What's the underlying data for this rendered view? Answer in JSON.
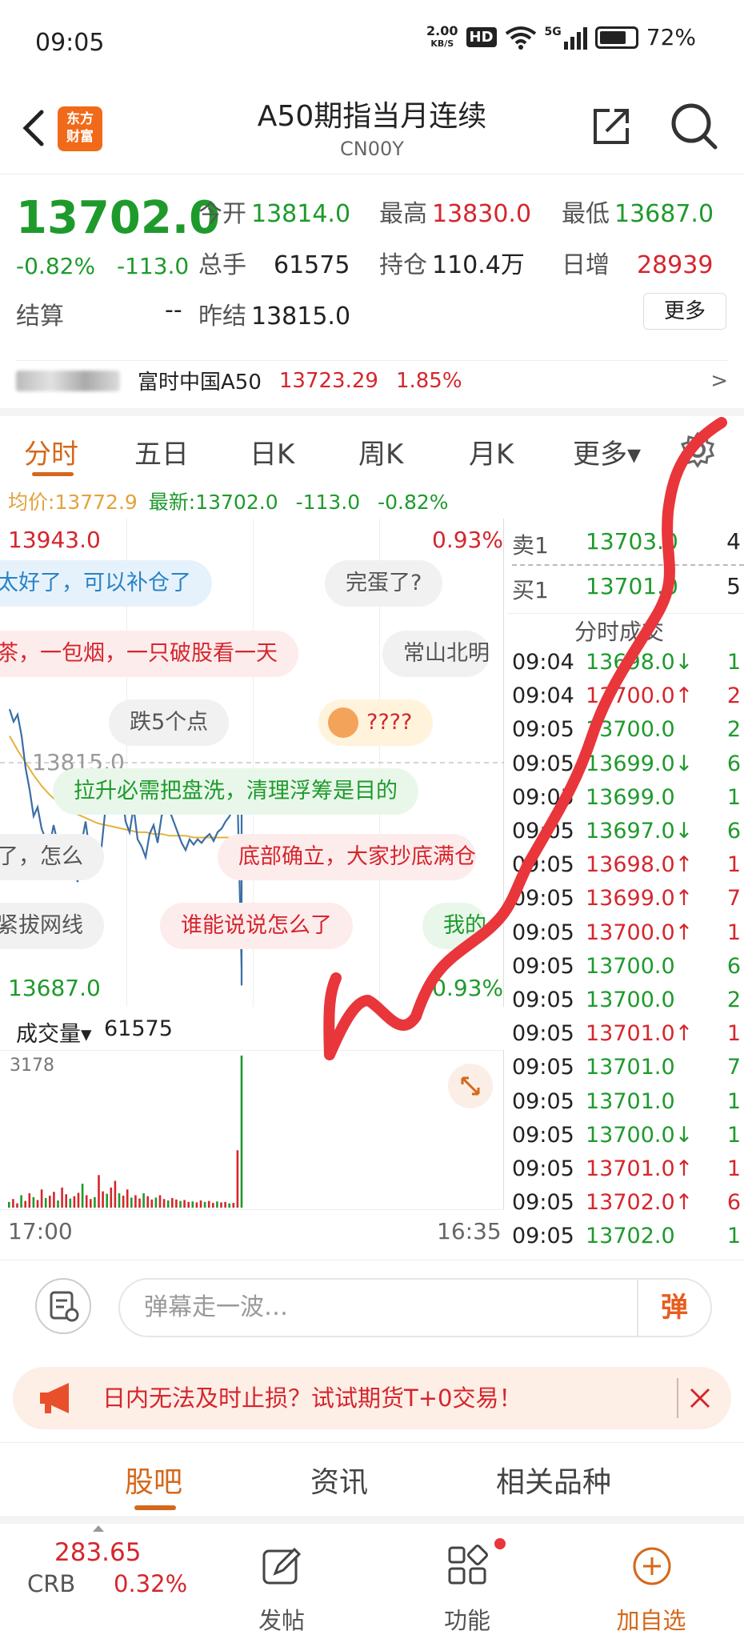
{
  "status": {
    "time": "09:05",
    "net_speed_value": "2.00",
    "net_speed_unit": "KB/S",
    "hd": "HD",
    "signal_label": "5G",
    "battery": "72%"
  },
  "header": {
    "logo_line1": "东方",
    "logo_line2": "财富",
    "title": "A50期指当月连续",
    "code": "CN00Y"
  },
  "quote": {
    "price": "13702.0",
    "change_pct": "-0.82%",
    "change": "-113.0",
    "open_label": "今开",
    "open": "13814.0",
    "high_label": "最高",
    "high": "13830.0",
    "low_label": "最低",
    "low": "13687.0",
    "volume_label": "总手",
    "volume": "61575",
    "oi_label": "持仓",
    "oi": "110.4万",
    "daily_inc_label": "日增",
    "daily_inc": "28939",
    "settle_label": "结算",
    "settle": "--",
    "prev_settle_label": "昨结",
    "prev_settle": "13815.0",
    "more": "更多",
    "related_name": "富时中国A50",
    "related_price": "13723.29",
    "related_pct": "1.85%",
    "related_arrow": ">"
  },
  "tabs": [
    {
      "label": "分时"
    },
    {
      "label": "五日"
    },
    {
      "label": "日K"
    },
    {
      "label": "周K"
    },
    {
      "label": "月K"
    },
    {
      "label": "更多▾"
    }
  ],
  "chart_info": {
    "avg_label": "均价:",
    "avg": "13772.9",
    "latest_label": "最新:",
    "latest": "13702.0",
    "change": "-113.0",
    "pct": "-0.82%"
  },
  "chart_data": {
    "type": "line",
    "y_top": "13943.0",
    "y_top_pct": "0.93%",
    "y_ref": "13815.0",
    "y_bottom": "13687.0",
    "y_bottom_pct": "-0.93%",
    "ylim": [
      13687.0,
      13943.0
    ],
    "x_start": "17:00",
    "x_end": "16:35",
    "price_series": [
      13845,
      13838,
      13842,
      13830,
      13812,
      13800,
      13785,
      13790,
      13778,
      13772,
      13768,
      13780,
      13770,
      13758,
      13752,
      13765,
      13760,
      13748,
      13770,
      13782,
      13765,
      13772,
      13760,
      13768,
      13790,
      13805,
      13795,
      13810,
      13800,
      13782,
      13776,
      13790,
      13772,
      13768,
      13762,
      13775,
      13780,
      13770,
      13785,
      13792,
      13788,
      13782,
      13776,
      13770,
      13766,
      13772,
      13769,
      13772,
      13770,
      13773,
      13775,
      13771,
      13776,
      13778,
      13782,
      13785,
      13790,
      13794,
      13700
    ],
    "avg_series": [
      13830,
      13822,
      13815,
      13808,
      13802,
      13797,
      13793,
      13790,
      13787,
      13785,
      13783,
      13781,
      13780,
      13779,
      13778,
      13777,
      13776,
      13776,
      13775,
      13775,
      13774,
      13774,
      13774,
      13773,
      13773,
      13773,
      13773,
      13773,
      13773,
      13773
    ],
    "volume_label": "成交量▾",
    "volume_total": "61575",
    "volume_max": "3178",
    "volume_bars": [
      120,
      180,
      90,
      260,
      140,
      300,
      220,
      160,
      380,
      200,
      250,
      330,
      150,
      420,
      280,
      190,
      240,
      310,
      500,
      260,
      180,
      220,
      680,
      340,
      290,
      420,
      560,
      300,
      250,
      380,
      210,
      260,
      190,
      300,
      240,
      170,
      210,
      260,
      180,
      150,
      200,
      170,
      140,
      160,
      120,
      130,
      110,
      150,
      120,
      140,
      100,
      130,
      110,
      120,
      90,
      100,
      1200,
      3178
    ]
  },
  "danmu": [
    {
      "text": "太好了，可以补仓了",
      "style": "blue"
    },
    {
      "text": "完蛋了?",
      "style": "gray"
    },
    {
      "text": "茶，一包烟，一只破股看一天",
      "style": "red"
    },
    {
      "text": "常山北明",
      "style": "gray"
    },
    {
      "text": "跌5个点",
      "style": "gray"
    },
    {
      "text": "????",
      "style": "yellow"
    },
    {
      "text": "拉升必需把盘洗，清理浮筹是目的",
      "style": "green"
    },
    {
      "text": "了，怎么",
      "style": "gray"
    },
    {
      "text": "底部确立，大家抄底满仓",
      "style": "red"
    },
    {
      "text": "紧拔网线",
      "style": "gray"
    },
    {
      "text": "谁能说说怎么了",
      "style": "red"
    },
    {
      "text": "我的",
      "style": "green"
    }
  ],
  "book": {
    "sell_label": "卖1",
    "sell_price": "13703.0",
    "sell_vol": "4",
    "buy_label": "买1",
    "buy_price": "13701.0",
    "buy_vol": "5",
    "ticks_title": "分时成交",
    "ticks": [
      {
        "time": "09:04",
        "price": "13698.0↓",
        "vol": "1",
        "dir": "down"
      },
      {
        "time": "09:04",
        "price": "13700.0↑",
        "vol": "2",
        "dir": "up"
      },
      {
        "time": "09:05",
        "price": "13700.0",
        "vol": "2",
        "dir": "flat"
      },
      {
        "time": "09:05",
        "price": "13699.0↓",
        "vol": "6",
        "dir": "down"
      },
      {
        "time": "09:05",
        "price": "13699.0",
        "vol": "1",
        "dir": "flat"
      },
      {
        "time": "09:05",
        "price": "13697.0↓",
        "vol": "6",
        "dir": "down"
      },
      {
        "time": "09:05",
        "price": "13698.0↑",
        "vol": "1",
        "dir": "up"
      },
      {
        "time": "09:05",
        "price": "13699.0↑",
        "vol": "7",
        "dir": "up"
      },
      {
        "time": "09:05",
        "price": "13700.0↑",
        "vol": "1",
        "dir": "up"
      },
      {
        "time": "09:05",
        "price": "13700.0",
        "vol": "6",
        "dir": "flat"
      },
      {
        "time": "09:05",
        "price": "13700.0",
        "vol": "2",
        "dir": "flat"
      },
      {
        "time": "09:05",
        "price": "13701.0↑",
        "vol": "1",
        "dir": "up"
      },
      {
        "time": "09:05",
        "price": "13701.0",
        "vol": "7",
        "dir": "flat"
      },
      {
        "time": "09:05",
        "price": "13701.0",
        "vol": "1",
        "dir": "flat"
      },
      {
        "time": "09:05",
        "price": "13700.0↓",
        "vol": "1",
        "dir": "down"
      },
      {
        "time": "09:05",
        "price": "13701.0↑",
        "vol": "1",
        "dir": "up"
      },
      {
        "time": "09:05",
        "price": "13702.0↑",
        "vol": "6",
        "dir": "up"
      },
      {
        "time": "09:05",
        "price": "13702.0",
        "vol": "1",
        "dir": "flat"
      }
    ]
  },
  "comment": {
    "placeholder": "弹幕走一波…",
    "send": "弹"
  },
  "promo": {
    "text": "日内无法及时止损？试试期货T+0交易！"
  },
  "subtabs": [
    {
      "label": "股吧"
    },
    {
      "label": "资讯"
    },
    {
      "label": "相关品种"
    }
  ],
  "nav": {
    "crb_value": "283.65",
    "crb_label": "CRB",
    "crb_pct": "0.32%",
    "post": "发帖",
    "func": "功能",
    "add": "加自选"
  },
  "colors": {
    "accent": "#d4681b",
    "up": "#d5262d",
    "down": "#1e9a2c",
    "price_line": "#3a6ea5",
    "avg_line": "#e3b23c",
    "annotation": "#e8363b"
  }
}
